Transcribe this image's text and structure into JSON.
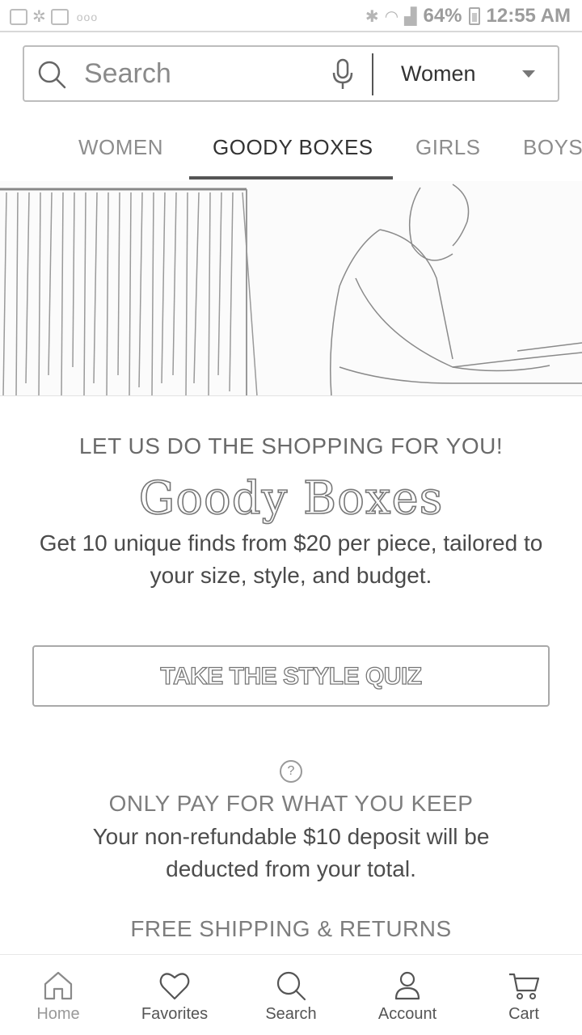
{
  "status_bar": {
    "battery": "64%",
    "time": "12:55 AM"
  },
  "search": {
    "placeholder": "Search",
    "department": "Women"
  },
  "tabs": [
    {
      "label": "WOMEN",
      "active": false
    },
    {
      "label": "GOODY BOXES",
      "active": true
    },
    {
      "label": "GIRLS",
      "active": false
    },
    {
      "label": "BOYS",
      "active": false
    }
  ],
  "content": {
    "eyebrow": "LET US DO THE SHOPPING FOR YOU!",
    "title": "Goody Boxes",
    "description": "Get 10 unique finds from $20 per piece, tailored to your size, style, and budget.",
    "cta": "TAKE THE STYLE QUIZ",
    "help_symbol": "?",
    "pay_title": "ONLY PAY FOR WHAT YOU KEEP",
    "pay_text": "Your non-refundable $10 deposit will be deducted from your total.",
    "shipping_title": "FREE SHIPPING & RETURNS"
  },
  "bottom_nav": [
    {
      "label": "Home",
      "icon": "home-icon"
    },
    {
      "label": "Favorites",
      "icon": "heart-icon"
    },
    {
      "label": "Search",
      "icon": "search-icon"
    },
    {
      "label": "Account",
      "icon": "account-icon"
    },
    {
      "label": "Cart",
      "icon": "cart-icon"
    }
  ]
}
